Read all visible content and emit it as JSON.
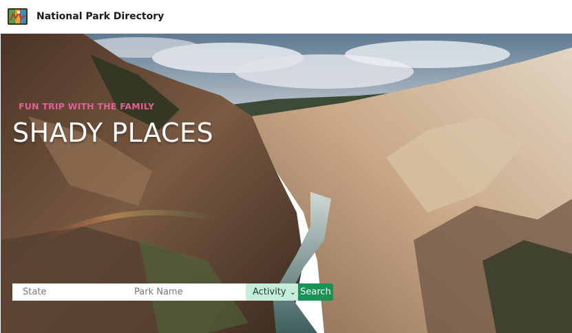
{
  "navbar": {
    "brand": "National Park Directory",
    "logo_icon": "park-map-icon"
  },
  "hero": {
    "tagline": "FUN TRIP WITH THE FAMILY",
    "headline": "SHADY PLACES",
    "background_image": "canyon-landscape"
  },
  "search": {
    "state_placeholder": "State",
    "park_placeholder": "Park Name",
    "activity_selected": "Activity",
    "button_label": "Search"
  },
  "colors": {
    "tagline": "#e45f95",
    "select_bg": "#c6eddb",
    "button_bg": "#179454"
  }
}
